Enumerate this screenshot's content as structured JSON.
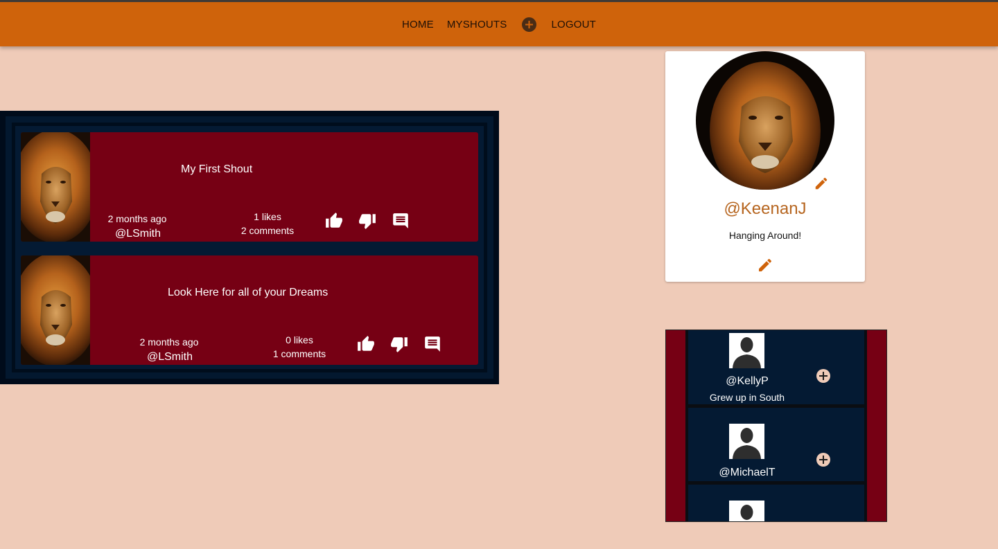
{
  "nav": {
    "home": "HOME",
    "myshouts": "MYSHOUTS",
    "logout": "LOGOUT"
  },
  "shouts": [
    {
      "title": "My First Shout",
      "time": "2 months ago",
      "user": "@LSmith",
      "likes": "1 likes",
      "comments": "2 comments"
    },
    {
      "title": "Look Here for all of your Dreams",
      "time": "2 months ago",
      "user": "@LSmith",
      "likes": "0 likes",
      "comments": "1 comments"
    }
  ],
  "profile": {
    "handle": "@KeenanJ",
    "bio": "Hanging Around!"
  },
  "users": [
    {
      "handle": "@KellyP",
      "bio": "Grew up in South"
    },
    {
      "handle": "@MichaelT",
      "bio": ""
    },
    {
      "handle": "",
      "bio": ""
    }
  ],
  "colors": {
    "topbar": "#cf630b",
    "background": "#efcbb8",
    "shout_card": "#760014",
    "navy": "#041a33",
    "accent": "#b6651f"
  },
  "icons": {
    "like": "thumb-up-icon",
    "dislike": "thumb-down-icon",
    "comment": "comment-icon",
    "edit": "pencil-icon",
    "add": "plus-circle-icon"
  }
}
